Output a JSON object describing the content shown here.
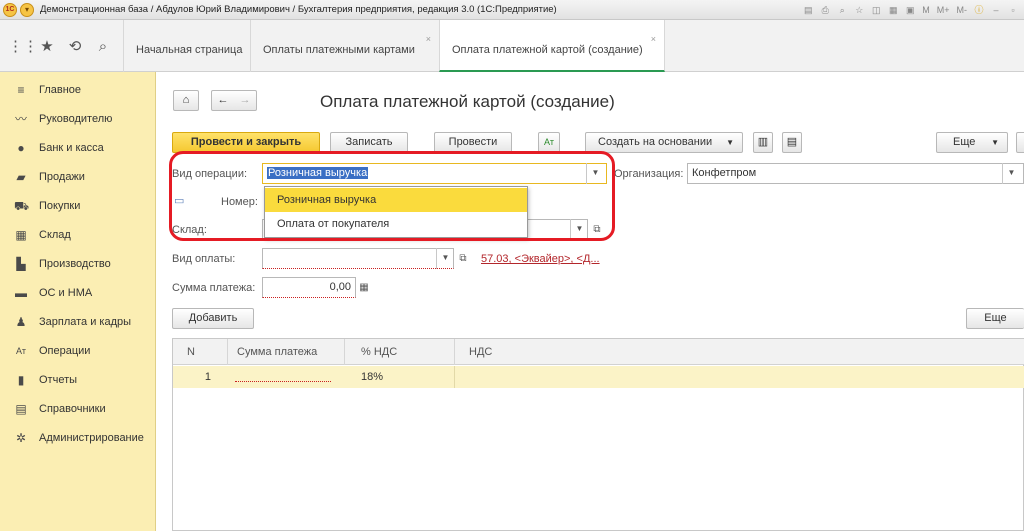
{
  "window": {
    "title": "Демонстрационная база / Абдулов Юрий Владимирович / Бухгалтерия предприятия, редакция 3.0  (1С:Предприятие)",
    "logo_text": "1С",
    "toolbar_text": [
      "M",
      "M+",
      "M-"
    ]
  },
  "tabs": [
    {
      "label": "Начальная страница",
      "closable": false
    },
    {
      "label": "Оплаты платежными картами",
      "closable": true
    },
    {
      "label": "Оплата платежной картой (создание)",
      "closable": true,
      "active": true
    }
  ],
  "sidebar": {
    "items": [
      {
        "label": "Главное",
        "icon": "menu-lines-icon"
      },
      {
        "label": "Руководителю",
        "icon": "trend-icon"
      },
      {
        "label": "Банк и касса",
        "icon": "ruble-icon"
      },
      {
        "label": "Продажи",
        "icon": "bag-icon"
      },
      {
        "label": "Покупки",
        "icon": "cart-icon"
      },
      {
        "label": "Склад",
        "icon": "warehouse-icon"
      },
      {
        "label": "Производство",
        "icon": "factory-icon"
      },
      {
        "label": "ОС и НМА",
        "icon": "truck-icon"
      },
      {
        "label": "Зарплата и кадры",
        "icon": "person-icon"
      },
      {
        "label": "Операции",
        "icon": "operations-icon"
      },
      {
        "label": "Отчеты",
        "icon": "bar-chart-icon"
      },
      {
        "label": "Справочники",
        "icon": "book-icon"
      },
      {
        "label": "Администрирование",
        "icon": "gear-icon"
      }
    ]
  },
  "document": {
    "title": "Оплата платежной картой (создание)",
    "buttons": {
      "post_close": "Провести и закрыть",
      "save": "Записать",
      "post": "Провести",
      "create_based": "Создать на основании",
      "more": "Еще",
      "add": "Добавить",
      "more2": "Еще"
    },
    "fields": {
      "operation_label": "Вид операции:",
      "operation_value": "Розничная выручка",
      "number_label": "Номер:",
      "organization_label": "Организация:",
      "organization_value": "Конфетпром",
      "warehouse_label": "Склад:",
      "payment_type_label": "Вид оплаты:",
      "payment_account_link": "57.03, <Эквайер>, <Д...",
      "amount_label": "Сумма платежа:",
      "amount_value": "0,00"
    },
    "dropdown": {
      "options": [
        "Розничная выручка",
        "Оплата от покупателя"
      ],
      "selected_index": 0
    },
    "table": {
      "columns": [
        "N",
        "Сумма платежа",
        "% НДС",
        "НДС"
      ],
      "rows": [
        {
          "n": "1",
          "amount": "",
          "vat_rate": "18%",
          "vat": ""
        }
      ]
    }
  },
  "colors": {
    "sidebar_bg": "#fbeeb3",
    "primary_button": "#f5c830",
    "highlight": "#e51b24",
    "active_tab_underline": "#2a9a52",
    "link": "#b3262b"
  }
}
